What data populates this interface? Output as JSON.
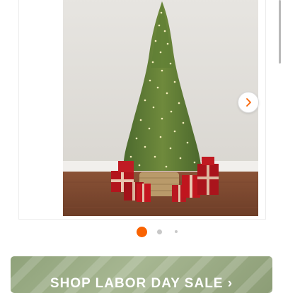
{
  "gallery": {
    "image_subject": "pre-lit artificial christmas tree with wrapped gifts",
    "next_icon": "chevron-right-icon",
    "slide_count": 3,
    "active_slide": 1,
    "colors": {
      "active_dot": "#f96302",
      "inactive_dot": "#c8c8c8"
    }
  },
  "promo": {
    "label": "SHOP LABOR DAY SALE ›",
    "colors": {
      "background": "#9cad86",
      "text": "#ffffff"
    }
  }
}
